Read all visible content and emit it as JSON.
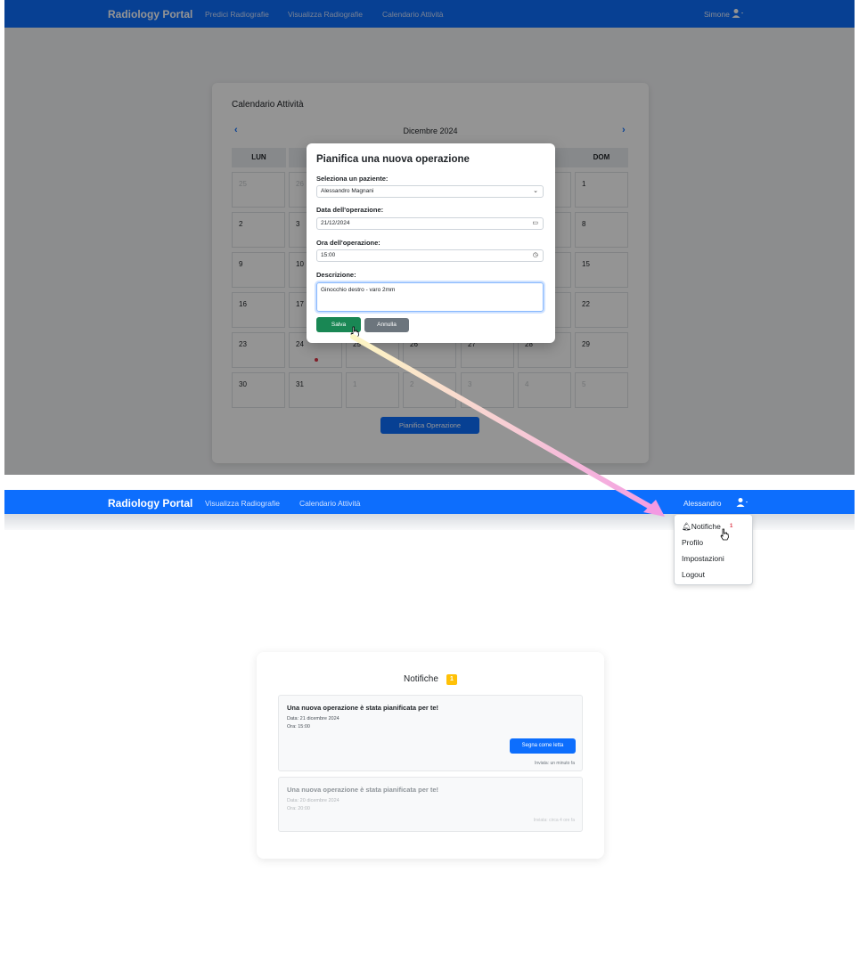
{
  "shot1": {
    "nav": {
      "brand": "Radiology Portal",
      "links": [
        "Predici Radiografie",
        "Visualizza Radiografie",
        "Calendario Attività"
      ],
      "user": "Simone"
    },
    "calendar": {
      "title": "Calendario Attività",
      "month": "Dicembre 2024",
      "weekdays": [
        "LUN",
        "DOM"
      ],
      "rows": [
        [
          "25",
          "26",
          "",
          "",
          "",
          "",
          "1"
        ],
        [
          "2",
          "3",
          "",
          "",
          "",
          "",
          "8"
        ],
        [
          "9",
          "10",
          "",
          "",
          "",
          "",
          "15"
        ],
        [
          "16",
          "17",
          "",
          "",
          "",
          "",
          "22"
        ],
        [
          "23",
          "24",
          "25",
          "26",
          "27",
          "28",
          "29"
        ],
        [
          "30",
          "31",
          "1",
          "2",
          "3",
          "4",
          "5"
        ]
      ],
      "plan_button": "Pianifica Operazione"
    },
    "modal": {
      "title": "Pianifica una nuova operazione",
      "patient_label": "Seleziona un paziente:",
      "patient_value": "Alessandro Magnani",
      "date_label": "Data dell'operazione:",
      "date_value": "21/12/2024",
      "time_label": "Ora dell'operazione:",
      "time_value": "15:00",
      "desc_label": "Descrizione:",
      "desc_value": "Ginocchio destro - varo 2mm",
      "save": "Salva",
      "cancel": "Annulla"
    }
  },
  "shot2": {
    "nav": {
      "brand": "Radiology Portal",
      "links": [
        "Visualizza Radiografie",
        "Calendario Attività"
      ],
      "user": "Alessandro"
    },
    "dropdown": {
      "notifiche": "Notifiche",
      "notifiche_badge": "1",
      "profilo": "Profilo",
      "impostazioni": "Impostazioni",
      "logout": "Logout"
    }
  },
  "notifications": {
    "title": "Notifiche",
    "count": "1",
    "items": [
      {
        "title": "Una nuova operazione è stata pianificata per te!",
        "date": "Data: 21 dicembre 2024",
        "time": "Ora: 15:00",
        "button": "Segna come letta",
        "sent": "Inviata: un minuto fa"
      },
      {
        "title": "Una nuova operazione è stata pianificata per te!",
        "date": "Data: 20 dicembre 2024",
        "time": "Ora: 20:00",
        "sent": "Inviata: circa 4 ore fa"
      }
    ]
  },
  "colors": {
    "primary": "#0d6efd",
    "success": "#198754",
    "secondary": "#6c757d",
    "warning": "#ffc107",
    "danger": "#dc3545"
  }
}
